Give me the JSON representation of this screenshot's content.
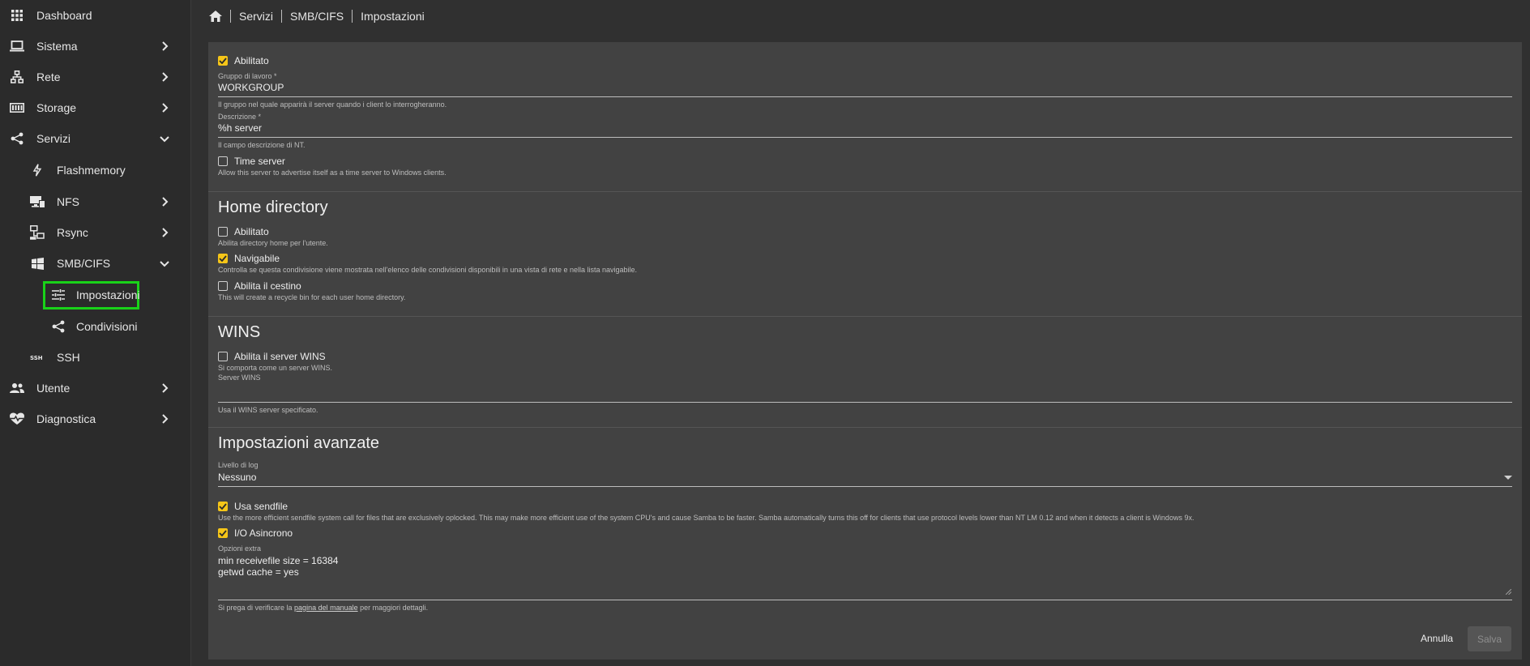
{
  "sidebar": {
    "items": [
      {
        "label": "Dashboard",
        "icon": "apps-grid-icon"
      },
      {
        "label": "Sistema",
        "icon": "laptop-icon"
      },
      {
        "label": "Rete",
        "icon": "network-icon"
      },
      {
        "label": "Storage",
        "icon": "storage-icon"
      },
      {
        "label": "Servizi",
        "icon": "share-icon"
      },
      {
        "label": "Flashmemory",
        "icon": "flash-icon"
      },
      {
        "label": "NFS",
        "icon": "nfs-icon"
      },
      {
        "label": "Rsync",
        "icon": "rsync-icon"
      },
      {
        "label": "SMB/CIFS",
        "icon": "windows-icon"
      },
      {
        "label": "Impostazioni",
        "icon": "tune-icon"
      },
      {
        "label": "Condivisioni",
        "icon": "share-icon"
      },
      {
        "label": "SSH",
        "icon": "ssh-icon"
      },
      {
        "label": "Utente",
        "icon": "users-icon"
      },
      {
        "label": "Diagnostica",
        "icon": "heart-pulse-icon"
      }
    ]
  },
  "breadcrumb": {
    "home_icon": "home-icon",
    "items": [
      "Servizi",
      "SMB/CIFS",
      "Impostazioni"
    ]
  },
  "general": {
    "enabled_label": "Abilitato",
    "enabled_checked": true,
    "workgroup_label": "Gruppo di lavoro *",
    "workgroup_value": "WORKGROUP",
    "workgroup_hint": "Il gruppo nel quale apparirà il server quando i client lo interrogheranno.",
    "description_label": "Descrizione *",
    "description_value": "%h server",
    "description_hint": "Il campo descrizione di NT.",
    "timeserver_label": "Time server",
    "timeserver_checked": false,
    "timeserver_hint": "Allow this server to advertise itself as a time server to Windows clients."
  },
  "home": {
    "title": "Home directory",
    "enabled_label": "Abilitato",
    "enabled_checked": false,
    "enabled_hint": "Abilita directory home per l'utente.",
    "browsable_label": "Navigabile",
    "browsable_checked": true,
    "browsable_hint": "Controlla se questa condivisione viene mostrata nell'elenco delle condivisioni disponibili in una vista di rete e nella lista navigabile.",
    "recycle_label": "Abilita il cestino",
    "recycle_checked": false,
    "recycle_hint": "This will create a recycle bin for each user home directory."
  },
  "wins": {
    "title": "WINS",
    "server_label": "Abilita il server WINS",
    "server_checked": false,
    "server_hint": "Si comporta come un server WINS.",
    "wins_server_label": "Server WINS",
    "wins_server_value": "",
    "wins_server_hint": "Usa il WINS server specificato."
  },
  "advanced": {
    "title": "Impostazioni avanzate",
    "log_label": "Livello di log",
    "log_value": "Nessuno",
    "sendfile_label": "Usa sendfile",
    "sendfile_checked": true,
    "sendfile_hint": "Use the more efficient sendfile system call for files that are exclusively oplocked. This may make more efficient use of the system CPU's and cause Samba to be faster. Samba automatically turns this off for clients that use protocol levels lower than NT LM 0.12 and when it detects a client is Windows 9x.",
    "aio_label": "I/O Asincrono",
    "aio_checked": true,
    "extra_label": "Opzioni extra",
    "extra_value": "min receivefile size = 16384\ngetwd cache = yes",
    "manual_hint_before": "Si prega di verificare la ",
    "manual_link": "pagina del manuale",
    "manual_hint_after": " per maggiori dettagli."
  },
  "actions": {
    "cancel": "Annulla",
    "save": "Salva"
  },
  "colors": {
    "accent": "#f5c518",
    "highlight": "#19d219"
  }
}
